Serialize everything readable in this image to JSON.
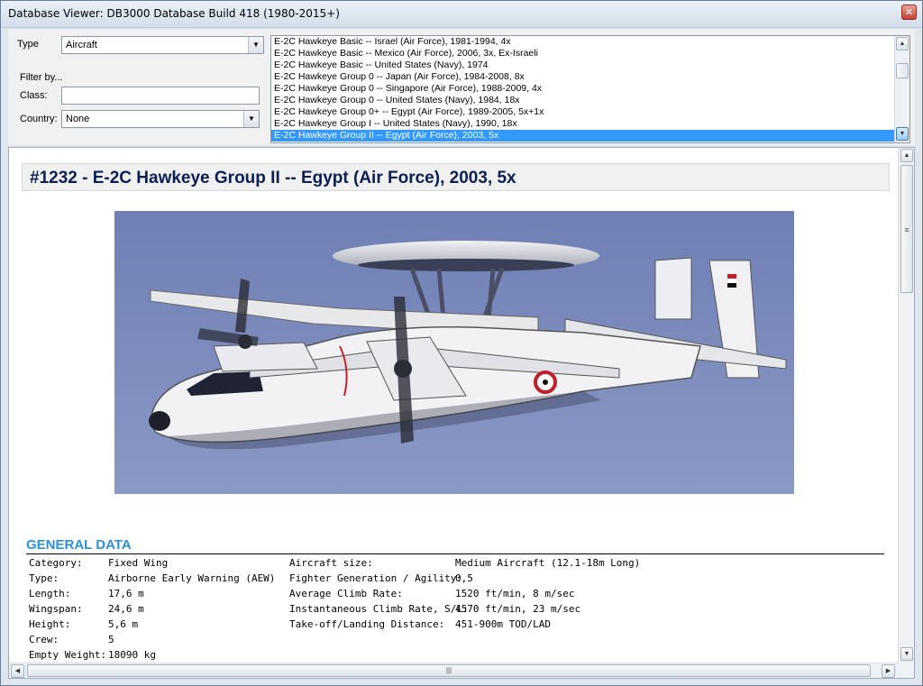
{
  "window": {
    "title": "Database Viewer: DB3000 Database Build 418 (1980-2015+)",
    "close_label": "✕"
  },
  "filters": {
    "type_label": "Type",
    "type_value": "Aircraft",
    "filter_by_label": "Filter by...",
    "class_label": "Class:",
    "class_value": "",
    "country_label": "Country:",
    "country_value": "None"
  },
  "list": {
    "items": [
      "E-2C Hawkeye Basic -- Israel (Air Force), 1981-1994, 4x",
      "E-2C Hawkeye Basic -- Mexico (Air Force), 2006, 3x, Ex-Israeli",
      "E-2C Hawkeye Basic -- United States (Navy), 1974",
      "E-2C Hawkeye Group 0 -- Japan (Air Force), 1984-2008, 8x",
      "E-2C Hawkeye Group 0 -- Singapore (Air Force), 1988-2009, 4x",
      "E-2C Hawkeye Group 0 -- United States (Navy), 1984, 18x",
      "E-2C Hawkeye Group 0+ -- Egypt (Air Force), 1989-2005, 5x+1x",
      "E-2C Hawkeye Group I -- United States (Navy), 1990, 18x",
      "E-2C Hawkeye Group II -- Egypt (Air Force), 2003, 5x"
    ],
    "selected_index": 8
  },
  "detail": {
    "heading": "#1232 - E-2C Hawkeye Group II -- Egypt (Air Force), 2003, 5x",
    "section_title": "GENERAL DATA",
    "left_rows": [
      {
        "label": "Category:",
        "value": "Fixed Wing"
      },
      {
        "label": "Type:",
        "value": "Airborne Early Warning (AEW)"
      },
      {
        "label": "Length:",
        "value": "17,6 m"
      },
      {
        "label": "Wingspan:",
        "value": "24,6 m"
      },
      {
        "label": "Height:",
        "value": "5,6 m"
      },
      {
        "label": "Crew:",
        "value": "5"
      },
      {
        "label": "Empty Weight:",
        "value": "18090 kg"
      }
    ],
    "right_rows": [
      {
        "label": "Aircraft size:",
        "value": "Medium Aircraft (12.1-18m Long)"
      },
      {
        "label": "Fighter Generation / Agility:",
        "value": "0,5"
      },
      {
        "label": "Average Climb Rate:",
        "value": "1520 ft/min, 8 m/sec"
      },
      {
        "label": "Instantaneous Climb Rate, S/L:",
        "value": "4570 ft/min, 23 m/sec"
      },
      {
        "label": "Take-off/Landing Distance:",
        "value": "451-900m TOD/LAD"
      }
    ]
  },
  "icons": {
    "scroll_up": "▲",
    "scroll_down": "▼",
    "scroll_left": "◀",
    "scroll_right": "▶",
    "combo_arrow": "▼",
    "grip_v": "≡",
    "grip_h": "|||"
  }
}
